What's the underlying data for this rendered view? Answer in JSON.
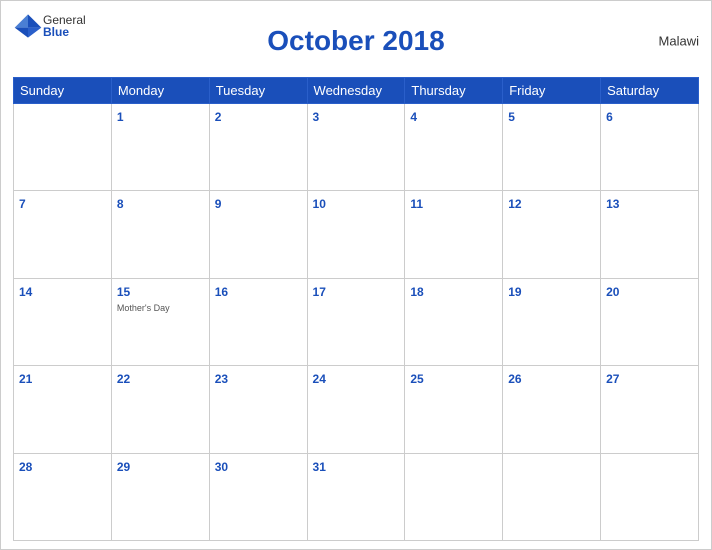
{
  "header": {
    "title": "October 2018",
    "country": "Malawi",
    "logo_general": "General",
    "logo_blue": "Blue"
  },
  "weekdays": [
    "Sunday",
    "Monday",
    "Tuesday",
    "Wednesday",
    "Thursday",
    "Friday",
    "Saturday"
  ],
  "weeks": [
    [
      {
        "day": "",
        "events": []
      },
      {
        "day": "1",
        "events": []
      },
      {
        "day": "2",
        "events": []
      },
      {
        "day": "3",
        "events": []
      },
      {
        "day": "4",
        "events": []
      },
      {
        "day": "5",
        "events": []
      },
      {
        "day": "6",
        "events": []
      }
    ],
    [
      {
        "day": "7",
        "events": []
      },
      {
        "day": "8",
        "events": []
      },
      {
        "day": "9",
        "events": []
      },
      {
        "day": "10",
        "events": []
      },
      {
        "day": "11",
        "events": []
      },
      {
        "day": "12",
        "events": []
      },
      {
        "day": "13",
        "events": []
      }
    ],
    [
      {
        "day": "14",
        "events": []
      },
      {
        "day": "15",
        "events": [
          "Mother's Day"
        ]
      },
      {
        "day": "16",
        "events": []
      },
      {
        "day": "17",
        "events": []
      },
      {
        "day": "18",
        "events": []
      },
      {
        "day": "19",
        "events": []
      },
      {
        "day": "20",
        "events": []
      }
    ],
    [
      {
        "day": "21",
        "events": []
      },
      {
        "day": "22",
        "events": []
      },
      {
        "day": "23",
        "events": []
      },
      {
        "day": "24",
        "events": []
      },
      {
        "day": "25",
        "events": []
      },
      {
        "day": "26",
        "events": []
      },
      {
        "day": "27",
        "events": []
      }
    ],
    [
      {
        "day": "28",
        "events": []
      },
      {
        "day": "29",
        "events": []
      },
      {
        "day": "30",
        "events": []
      },
      {
        "day": "31",
        "events": []
      },
      {
        "day": "",
        "events": []
      },
      {
        "day": "",
        "events": []
      },
      {
        "day": "",
        "events": []
      }
    ]
  ],
  "colors": {
    "header_bg": "#1a4fba",
    "header_text": "#ffffff",
    "day_number": "#1a4fba",
    "border": "#cccccc"
  }
}
